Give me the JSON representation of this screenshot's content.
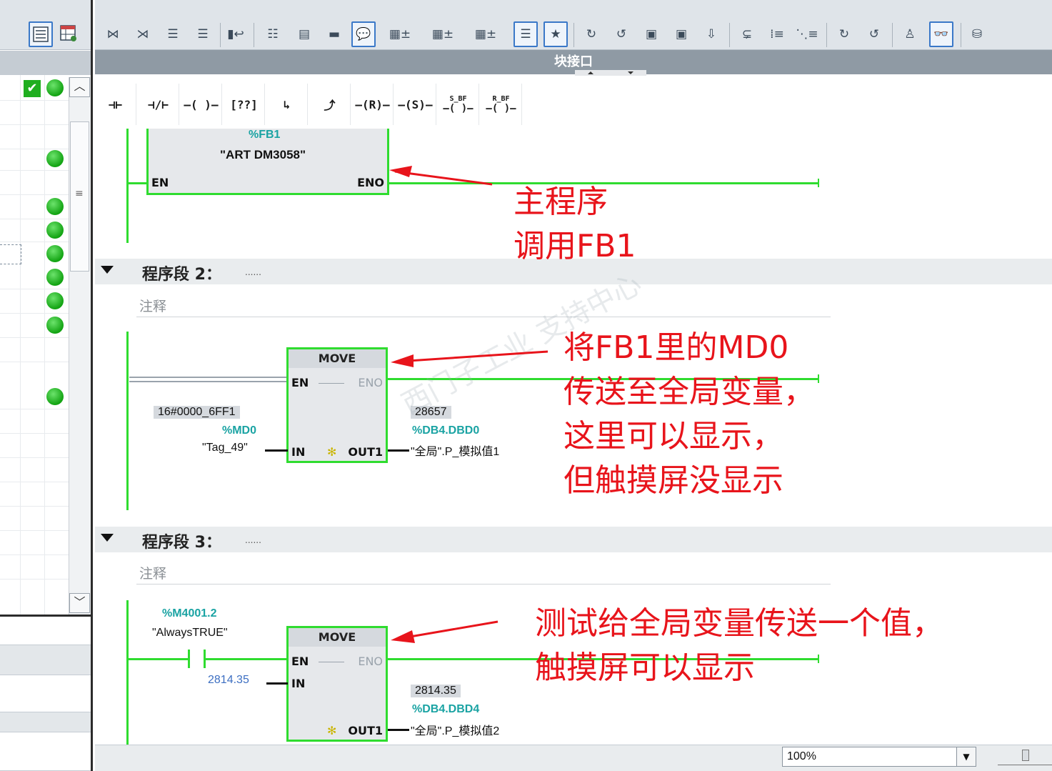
{
  "block_interface": {
    "title": "块接口"
  },
  "toolbar_icons": [
    "network-insert-icon",
    "network-delete-icon",
    "network-insert-row-icon",
    "network-append-row-icon",
    "compile-icon",
    "open-all-networks-icon",
    "close-all-networks-icon",
    "network-comment-icon",
    "toggle-comment-icon",
    "absolute-operand-icon",
    "symbolic-operand-icon",
    "operand-info-icon",
    "tag-info-icon",
    "show-favorites-icon",
    "go-to-error-icon",
    "next-error-icon",
    "previous-error-icon",
    "download-icon",
    "monitor-icon",
    "toggle-monitoring-icon",
    "force-icon",
    "block-compare-icon",
    "simulation-icon",
    "online-icon"
  ],
  "instructions": [
    {
      "name": "no-contact",
      "label": "⊣⊢"
    },
    {
      "name": "nc-contact",
      "label": "⊣/⊢"
    },
    {
      "name": "coil",
      "label": "–( )–"
    },
    {
      "name": "empty-box",
      "label": "[??]"
    },
    {
      "name": "open-branch",
      "label": "↳"
    },
    {
      "name": "close-branch",
      "label": "⤴"
    },
    {
      "name": "reset-coil",
      "label": "–(R)–"
    },
    {
      "name": "set-coil",
      "label": "–(S)–"
    },
    {
      "name": "set-bit-field",
      "label": "S_BF"
    },
    {
      "name": "reset-bit-field",
      "label": "R_BF"
    }
  ],
  "network1": {
    "block_address": "%FB1",
    "block_name": "\"ART DM3058\"",
    "en": "EN",
    "eno": "ENO"
  },
  "network2": {
    "title": "程序段 2：",
    "dots": "......",
    "comment": "注释",
    "block_name": "MOVE",
    "en": "EN",
    "eno": "ENO",
    "in": "IN",
    "out": "OUT1",
    "in_monitor": "16#0000_6FF1",
    "in_address": "%MD0",
    "in_tag": "\"Tag_49\"",
    "out_monitor": "28657",
    "out_address": "%DB4.DBD0",
    "out_tag": "\"全局\".P_模拟值1"
  },
  "network3": {
    "title": "程序段 3：",
    "dots": "......",
    "comment": "注释",
    "contact_address": "%M4001.2",
    "contact_tag": "\"AlwaysTRUE\"",
    "block_name": "MOVE",
    "en": "EN",
    "eno": "ENO",
    "in": "IN",
    "out": "OUT1",
    "in_value": "2814.35",
    "out_monitor": "2814.35",
    "out_address": "%DB4.DBD4",
    "out_tag": "\"全局\".P_模拟值2"
  },
  "annotations": {
    "a1": [
      "主程序",
      "调用FB1"
    ],
    "a2": [
      "将FB1里的MD0",
      "传送至全局变量，",
      "这里可以显示，",
      "但触摸屏没显示"
    ],
    "a3": [
      "测试给全局变量传送一个值，",
      "触摸屏可以显示"
    ]
  },
  "zoom": {
    "value": "100%"
  },
  "colors": {
    "rail": "#2fdc2f",
    "annotation": "#e8141b",
    "address": "#1aa3a3",
    "status_green": "#12a312"
  }
}
